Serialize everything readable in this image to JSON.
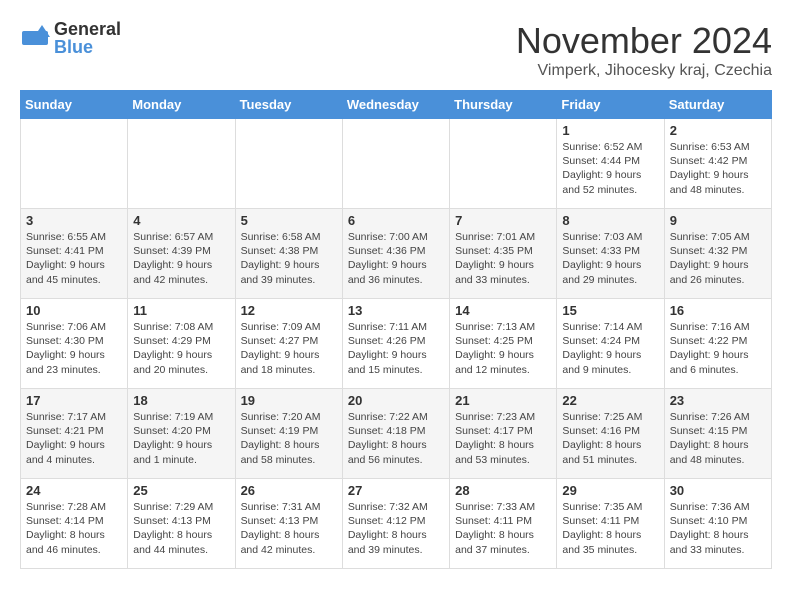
{
  "logo": {
    "general": "General",
    "blue": "Blue"
  },
  "title": "November 2024",
  "location": "Vimperk, Jihocesky kraj, Czechia",
  "days_header": [
    "Sunday",
    "Monday",
    "Tuesday",
    "Wednesday",
    "Thursday",
    "Friday",
    "Saturday"
  ],
  "weeks": [
    [
      {
        "day": "",
        "info": ""
      },
      {
        "day": "",
        "info": ""
      },
      {
        "day": "",
        "info": ""
      },
      {
        "day": "",
        "info": ""
      },
      {
        "day": "",
        "info": ""
      },
      {
        "day": "1",
        "info": "Sunrise: 6:52 AM\nSunset: 4:44 PM\nDaylight: 9 hours\nand 52 minutes."
      },
      {
        "day": "2",
        "info": "Sunrise: 6:53 AM\nSunset: 4:42 PM\nDaylight: 9 hours\nand 48 minutes."
      }
    ],
    [
      {
        "day": "3",
        "info": "Sunrise: 6:55 AM\nSunset: 4:41 PM\nDaylight: 9 hours\nand 45 minutes."
      },
      {
        "day": "4",
        "info": "Sunrise: 6:57 AM\nSunset: 4:39 PM\nDaylight: 9 hours\nand 42 minutes."
      },
      {
        "day": "5",
        "info": "Sunrise: 6:58 AM\nSunset: 4:38 PM\nDaylight: 9 hours\nand 39 minutes."
      },
      {
        "day": "6",
        "info": "Sunrise: 7:00 AM\nSunset: 4:36 PM\nDaylight: 9 hours\nand 36 minutes."
      },
      {
        "day": "7",
        "info": "Sunrise: 7:01 AM\nSunset: 4:35 PM\nDaylight: 9 hours\nand 33 minutes."
      },
      {
        "day": "8",
        "info": "Sunrise: 7:03 AM\nSunset: 4:33 PM\nDaylight: 9 hours\nand 29 minutes."
      },
      {
        "day": "9",
        "info": "Sunrise: 7:05 AM\nSunset: 4:32 PM\nDaylight: 9 hours\nand 26 minutes."
      }
    ],
    [
      {
        "day": "10",
        "info": "Sunrise: 7:06 AM\nSunset: 4:30 PM\nDaylight: 9 hours\nand 23 minutes."
      },
      {
        "day": "11",
        "info": "Sunrise: 7:08 AM\nSunset: 4:29 PM\nDaylight: 9 hours\nand 20 minutes."
      },
      {
        "day": "12",
        "info": "Sunrise: 7:09 AM\nSunset: 4:27 PM\nDaylight: 9 hours\nand 18 minutes."
      },
      {
        "day": "13",
        "info": "Sunrise: 7:11 AM\nSunset: 4:26 PM\nDaylight: 9 hours\nand 15 minutes."
      },
      {
        "day": "14",
        "info": "Sunrise: 7:13 AM\nSunset: 4:25 PM\nDaylight: 9 hours\nand 12 minutes."
      },
      {
        "day": "15",
        "info": "Sunrise: 7:14 AM\nSunset: 4:24 PM\nDaylight: 9 hours\nand 9 minutes."
      },
      {
        "day": "16",
        "info": "Sunrise: 7:16 AM\nSunset: 4:22 PM\nDaylight: 9 hours\nand 6 minutes."
      }
    ],
    [
      {
        "day": "17",
        "info": "Sunrise: 7:17 AM\nSunset: 4:21 PM\nDaylight: 9 hours\nand 4 minutes."
      },
      {
        "day": "18",
        "info": "Sunrise: 7:19 AM\nSunset: 4:20 PM\nDaylight: 9 hours\nand 1 minute."
      },
      {
        "day": "19",
        "info": "Sunrise: 7:20 AM\nSunset: 4:19 PM\nDaylight: 8 hours\nand 58 minutes."
      },
      {
        "day": "20",
        "info": "Sunrise: 7:22 AM\nSunset: 4:18 PM\nDaylight: 8 hours\nand 56 minutes."
      },
      {
        "day": "21",
        "info": "Sunrise: 7:23 AM\nSunset: 4:17 PM\nDaylight: 8 hours\nand 53 minutes."
      },
      {
        "day": "22",
        "info": "Sunrise: 7:25 AM\nSunset: 4:16 PM\nDaylight: 8 hours\nand 51 minutes."
      },
      {
        "day": "23",
        "info": "Sunrise: 7:26 AM\nSunset: 4:15 PM\nDaylight: 8 hours\nand 48 minutes."
      }
    ],
    [
      {
        "day": "24",
        "info": "Sunrise: 7:28 AM\nSunset: 4:14 PM\nDaylight: 8 hours\nand 46 minutes."
      },
      {
        "day": "25",
        "info": "Sunrise: 7:29 AM\nSunset: 4:13 PM\nDaylight: 8 hours\nand 44 minutes."
      },
      {
        "day": "26",
        "info": "Sunrise: 7:31 AM\nSunset: 4:13 PM\nDaylight: 8 hours\nand 42 minutes."
      },
      {
        "day": "27",
        "info": "Sunrise: 7:32 AM\nSunset: 4:12 PM\nDaylight: 8 hours\nand 39 minutes."
      },
      {
        "day": "28",
        "info": "Sunrise: 7:33 AM\nSunset: 4:11 PM\nDaylight: 8 hours\nand 37 minutes."
      },
      {
        "day": "29",
        "info": "Sunrise: 7:35 AM\nSunset: 4:11 PM\nDaylight: 8 hours\nand 35 minutes."
      },
      {
        "day": "30",
        "info": "Sunrise: 7:36 AM\nSunset: 4:10 PM\nDaylight: 8 hours\nand 33 minutes."
      }
    ]
  ]
}
